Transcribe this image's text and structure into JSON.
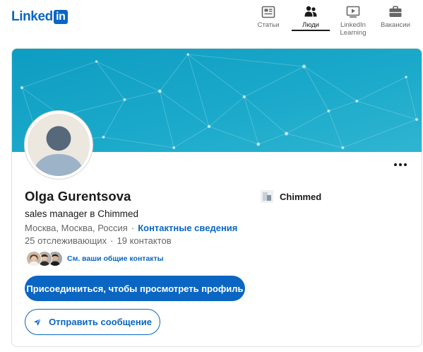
{
  "header": {
    "logo_text": "Linked",
    "logo_box_text": "in",
    "nav": [
      {
        "label": "Статьи",
        "icon": "articles-icon",
        "active": false
      },
      {
        "label": "Люди",
        "icon": "people-icon",
        "active": true
      },
      {
        "label": "LinkedIn Learning",
        "icon": "learning-icon",
        "active": false
      },
      {
        "label": "Вакансии",
        "icon": "briefcase-icon",
        "active": false
      }
    ]
  },
  "profile": {
    "name": "Olga Gurentsova",
    "headline": "sales manager в Chimmed",
    "location": "Москва, Москва, Россия",
    "contact_link": "Контактные сведения",
    "followers": "25 отслеживающих",
    "connections": "19 контактов",
    "mutual_connections_text": "См. ваши общие контакты",
    "company": "Chimmed",
    "primary_button": "Присоединиться, чтобы просмотреть профиль",
    "message_button": "Отправить сообщение",
    "separator": "·"
  },
  "colors": {
    "brand_blue": "#0a66c2",
    "banner_start": "#0e9dc2",
    "banner_end": "#31b7d2",
    "text_primary": "#000000e6",
    "text_secondary": "#666666"
  }
}
